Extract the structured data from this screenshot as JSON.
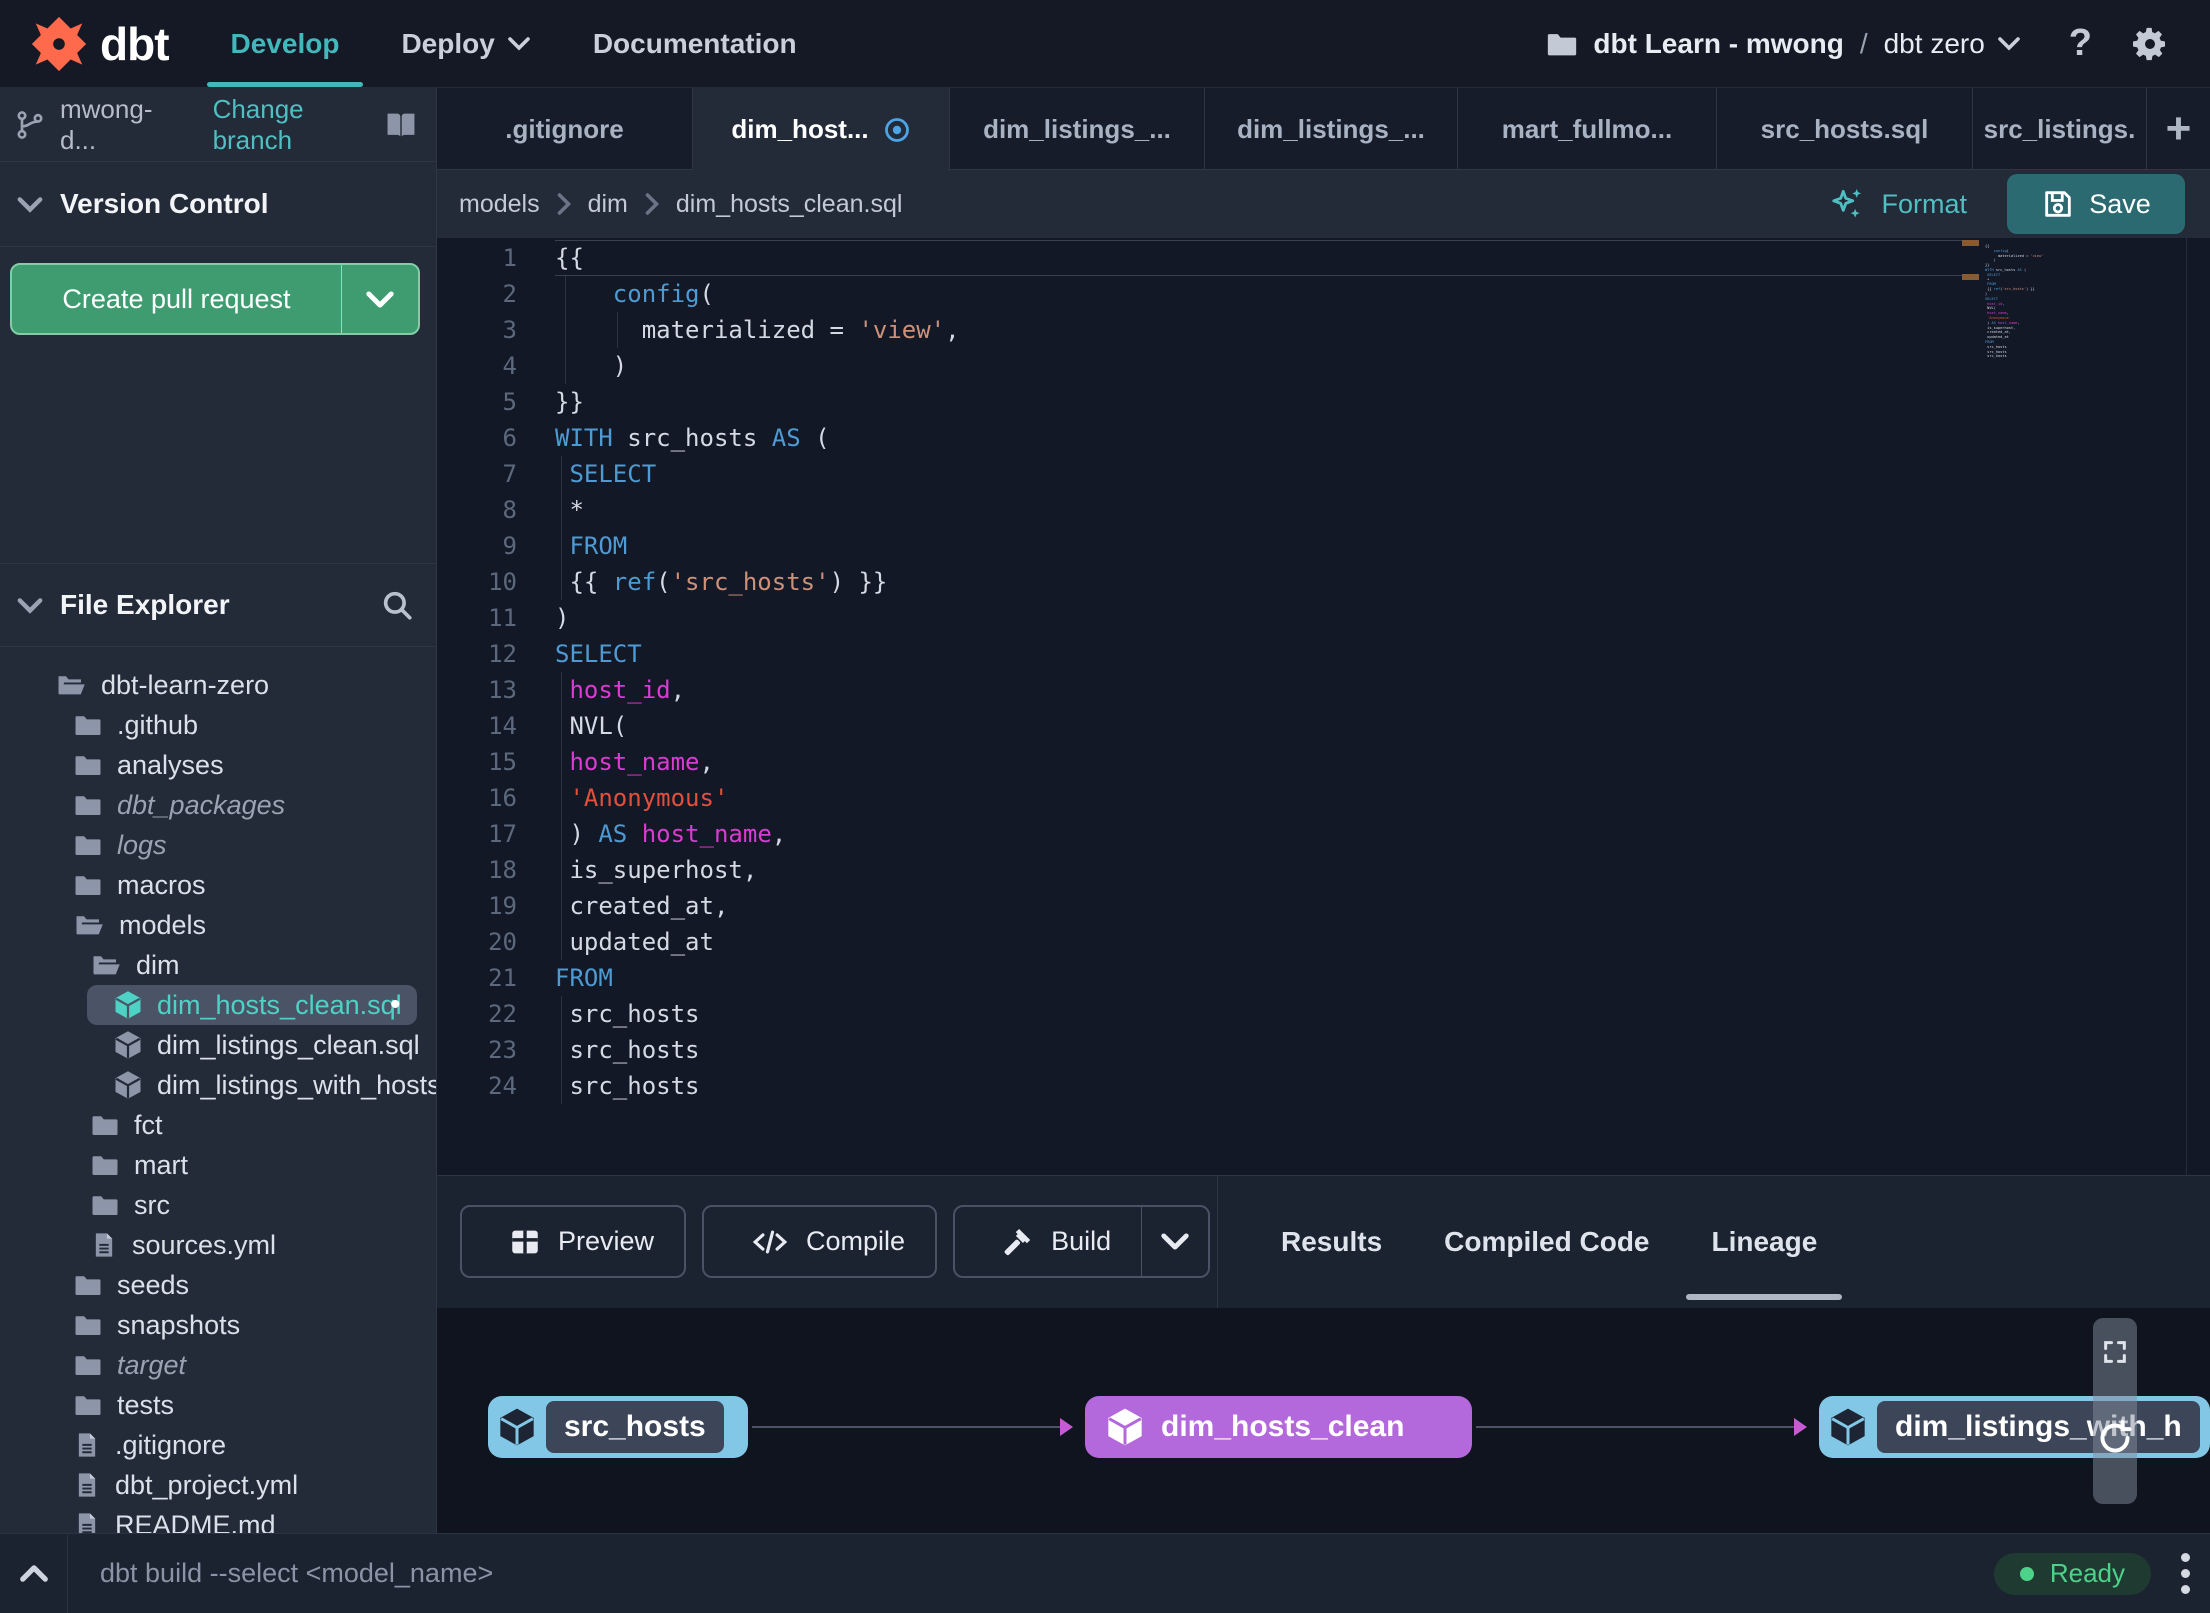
{
  "nav": {
    "brand": "dbt",
    "menus": [
      {
        "label": "Develop",
        "active": true
      },
      {
        "label": "Deploy",
        "caret": true
      },
      {
        "label": "Documentation"
      }
    ],
    "project": {
      "name": "dbt Learn - mwong",
      "separator": "/",
      "env": "dbt zero"
    }
  },
  "branch_bar": {
    "branch_name": "mwong-d...",
    "change_branch_label": "Change branch"
  },
  "version_control": {
    "title": "Version Control",
    "create_pr_label": "Create pull request"
  },
  "file_explorer": {
    "title": "File Explorer",
    "tree": [
      {
        "label": "dbt-learn-zero",
        "icon": "folder-open-icon",
        "level": 0
      },
      {
        "label": ".github",
        "icon": "folder-icon",
        "level": 1
      },
      {
        "label": "analyses",
        "icon": "folder-icon",
        "level": 1
      },
      {
        "label": "dbt_packages",
        "icon": "folder-icon",
        "level": 1,
        "italic": true
      },
      {
        "label": "logs",
        "icon": "folder-icon",
        "level": 1,
        "italic": true
      },
      {
        "label": "macros",
        "icon": "folder-icon",
        "level": 1
      },
      {
        "label": "models",
        "icon": "folder-open-icon",
        "level": 1
      },
      {
        "label": "dim",
        "icon": "folder-open-icon",
        "level": 2
      },
      {
        "label": "dim_hosts_clean.sql",
        "icon": "model-icon",
        "level": 3,
        "selected": true,
        "dot": true
      },
      {
        "label": "dim_listings_clean.sql",
        "icon": "model-icon",
        "level": 3
      },
      {
        "label": "dim_listings_with_hosts...",
        "icon": "model-icon",
        "level": 3
      },
      {
        "label": "fct",
        "icon": "folder-icon",
        "level": 2
      },
      {
        "label": "mart",
        "icon": "folder-icon",
        "level": 2
      },
      {
        "label": "src",
        "icon": "folder-icon",
        "level": 2
      },
      {
        "label": "sources.yml",
        "icon": "file-icon",
        "level": 2
      },
      {
        "label": "seeds",
        "icon": "folder-icon",
        "level": 1
      },
      {
        "label": "snapshots",
        "icon": "folder-icon",
        "level": 1
      },
      {
        "label": "target",
        "icon": "folder-icon",
        "level": 1,
        "italic": true
      },
      {
        "label": "tests",
        "icon": "folder-icon",
        "level": 1
      },
      {
        "label": ".gitignore",
        "icon": "file-icon",
        "level": 1
      },
      {
        "label": "dbt_project.yml",
        "icon": "file-icon",
        "level": 1
      },
      {
        "label": "README.md",
        "icon": "file-icon",
        "level": 1
      }
    ]
  },
  "editor": {
    "tabs": [
      {
        "label": ".gitignore"
      },
      {
        "label": "dim_host...",
        "active": true,
        "modified": true
      },
      {
        "label": "dim_listings_..."
      },
      {
        "label": "dim_listings_..."
      },
      {
        "label": "mart_fullmo..."
      },
      {
        "label": "src_hosts.sql"
      },
      {
        "label": "src_listings."
      }
    ],
    "breadcrumb": [
      "models",
      "dim",
      "dim_hosts_clean.sql"
    ],
    "format_label": "Format",
    "save_label": "Save",
    "lines": [
      {
        "n": 1,
        "cur": true,
        "t": [
          [
            "p",
            "{{"
          ]
        ]
      },
      {
        "n": 2,
        "g": [
          10
        ],
        "t": [
          [
            "p",
            "    "
          ],
          [
            "k",
            "config"
          ],
          [
            "p",
            "("
          ]
        ]
      },
      {
        "n": 3,
        "g": [
          10,
          62
        ],
        "t": [
          [
            "p",
            "      materialized = "
          ],
          [
            "s",
            "'view'"
          ],
          [
            "p",
            ","
          ]
        ]
      },
      {
        "n": 4,
        "g": [
          10
        ],
        "t": [
          [
            "p",
            "    )"
          ]
        ]
      },
      {
        "n": 5,
        "t": [
          [
            "p",
            "}}"
          ]
        ]
      },
      {
        "n": 6,
        "t": [
          [
            "k",
            "WITH"
          ],
          [
            "p",
            " src_hosts "
          ],
          [
            "k",
            "AS"
          ],
          [
            "p",
            " ("
          ]
        ]
      },
      {
        "n": 7,
        "g": [
          6
        ],
        "t": [
          [
            "p",
            " "
          ],
          [
            "k",
            "SELECT"
          ]
        ]
      },
      {
        "n": 8,
        "g": [
          6
        ],
        "t": [
          [
            "p",
            " *"
          ]
        ]
      },
      {
        "n": 9,
        "g": [
          6
        ],
        "t": [
          [
            "p",
            " "
          ],
          [
            "k",
            "FROM"
          ]
        ]
      },
      {
        "n": 10,
        "g": [
          6
        ],
        "t": [
          [
            "p",
            " {{ "
          ],
          [
            "k",
            "ref"
          ],
          [
            "p",
            "("
          ],
          [
            "s",
            "'src_hosts'"
          ],
          [
            "p",
            ") }}"
          ]
        ]
      },
      {
        "n": 11,
        "t": [
          [
            "p",
            ")"
          ]
        ]
      },
      {
        "n": 12,
        "t": [
          [
            "k",
            "SELECT"
          ]
        ]
      },
      {
        "n": 13,
        "g": [
          6
        ],
        "t": [
          [
            "p",
            " "
          ],
          [
            "m",
            "host_id"
          ],
          [
            "p",
            ","
          ]
        ]
      },
      {
        "n": 14,
        "g": [
          6
        ],
        "t": [
          [
            "p",
            " NVL("
          ]
        ]
      },
      {
        "n": 15,
        "g": [
          6
        ],
        "t": [
          [
            "p",
            " "
          ],
          [
            "m",
            "host_name"
          ],
          [
            "p",
            ","
          ]
        ]
      },
      {
        "n": 16,
        "g": [
          6
        ],
        "t": [
          [
            "p",
            " "
          ],
          [
            "r",
            "'Anonymous'"
          ]
        ]
      },
      {
        "n": 17,
        "g": [
          6
        ],
        "t": [
          [
            "p",
            " ) "
          ],
          [
            "k",
            "AS"
          ],
          [
            "p",
            " "
          ],
          [
            "m",
            "host_name"
          ],
          [
            "p",
            ","
          ]
        ]
      },
      {
        "n": 18,
        "g": [
          6
        ],
        "t": [
          [
            "p",
            " is_superhost,"
          ]
        ]
      },
      {
        "n": 19,
        "g": [
          6
        ],
        "t": [
          [
            "p",
            " created_at,"
          ]
        ]
      },
      {
        "n": 20,
        "g": [
          6
        ],
        "t": [
          [
            "p",
            " updated_at"
          ]
        ]
      },
      {
        "n": 21,
        "t": [
          [
            "k",
            "FROM"
          ]
        ]
      },
      {
        "n": 22,
        "g": [
          6
        ],
        "t": [
          [
            "p",
            " src_hosts"
          ]
        ]
      },
      {
        "n": 23,
        "g": [
          6
        ],
        "t": [
          [
            "p",
            " src_hosts"
          ]
        ]
      },
      {
        "n": 24,
        "g": [
          6
        ],
        "t": [
          [
            "p",
            " src_hosts"
          ]
        ]
      }
    ]
  },
  "bottom_panel": {
    "buttons": [
      {
        "label": "Preview",
        "icon": "table-icon"
      },
      {
        "label": "Compile",
        "icon": "code-icon"
      },
      {
        "label": "Build",
        "icon": "hammer-icon",
        "split": true
      }
    ],
    "tabs": [
      {
        "label": "Results"
      },
      {
        "label": "Compiled Code"
      },
      {
        "label": "Lineage",
        "active": true
      }
    ]
  },
  "lineage": {
    "nodes": [
      {
        "label": "src_hosts",
        "kind": "source"
      },
      {
        "label": "dim_hosts_clean",
        "kind": "model"
      },
      {
        "label": "dim_listings_with_h",
        "kind": "source"
      }
    ]
  },
  "command_bar": {
    "command": "dbt build --select <model_name>",
    "status": "Ready"
  },
  "colors": {
    "accent_teal": "#43b8bc",
    "green_button": "#3e9c70",
    "save_button": "#2b6a71",
    "ready_green": "#4dd28a",
    "node_source_blue": "#83c7e6",
    "node_model_purple": "#b368db",
    "edge_arrow_magenta": "#c75bd3",
    "token_keyword": "#4e9ad3",
    "token_string": "#ce9178",
    "token_string_red": "#e2503b",
    "token_column": "#d93bd3"
  }
}
